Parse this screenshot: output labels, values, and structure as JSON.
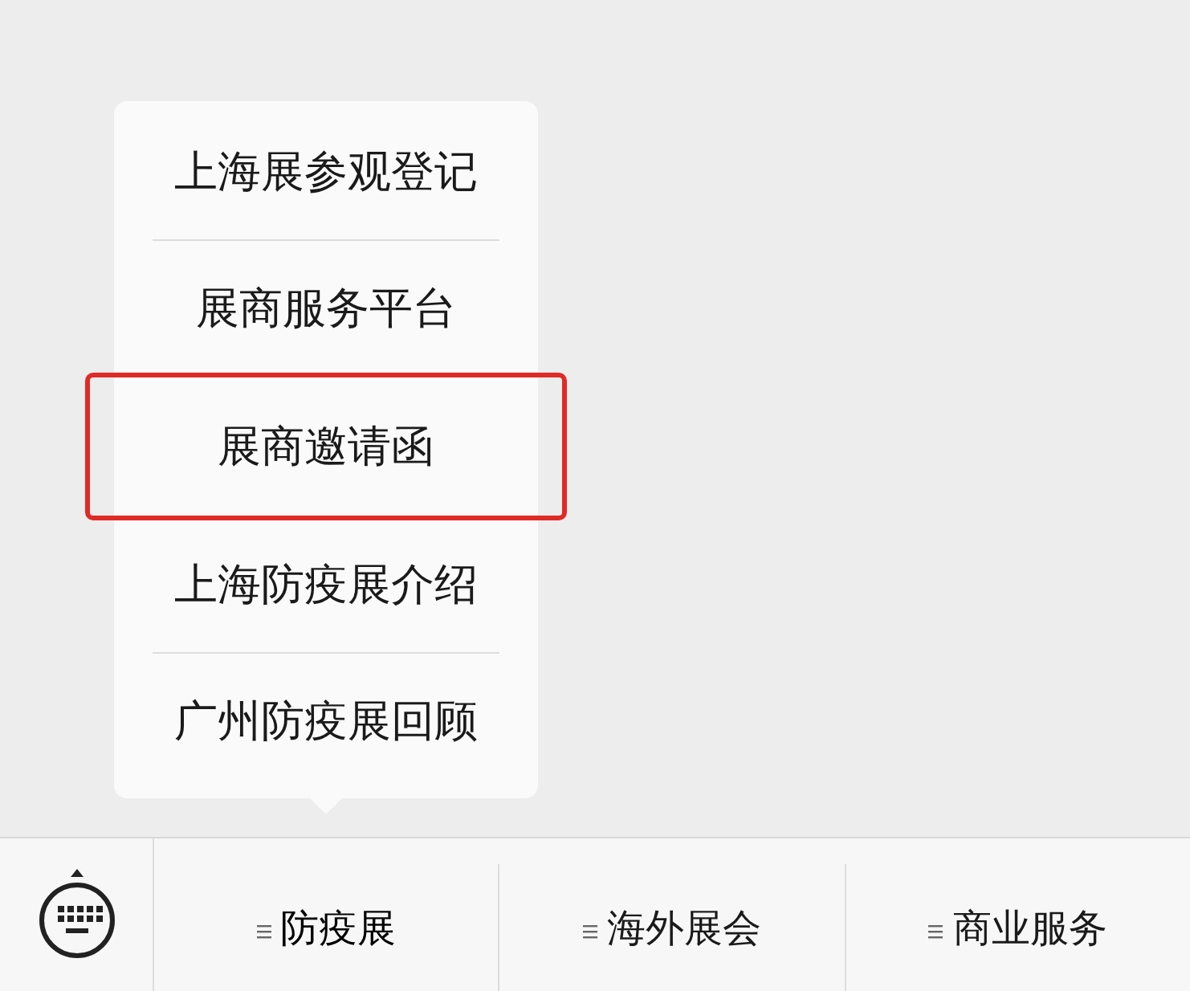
{
  "popup_menu": {
    "items": [
      {
        "label": "上海展参观登记",
        "highlighted": false
      },
      {
        "label": "展商服务平台",
        "highlighted": false
      },
      {
        "label": "展商邀请函",
        "highlighted": true
      },
      {
        "label": "上海防疫展介绍",
        "highlighted": false
      },
      {
        "label": "广州防疫展回顾",
        "highlighted": false
      }
    ]
  },
  "menu_bar": {
    "tabs": [
      {
        "label": "防疫展",
        "selected": true
      },
      {
        "label": "海外展会",
        "selected": false
      },
      {
        "label": "商业服务",
        "selected": false
      }
    ]
  }
}
